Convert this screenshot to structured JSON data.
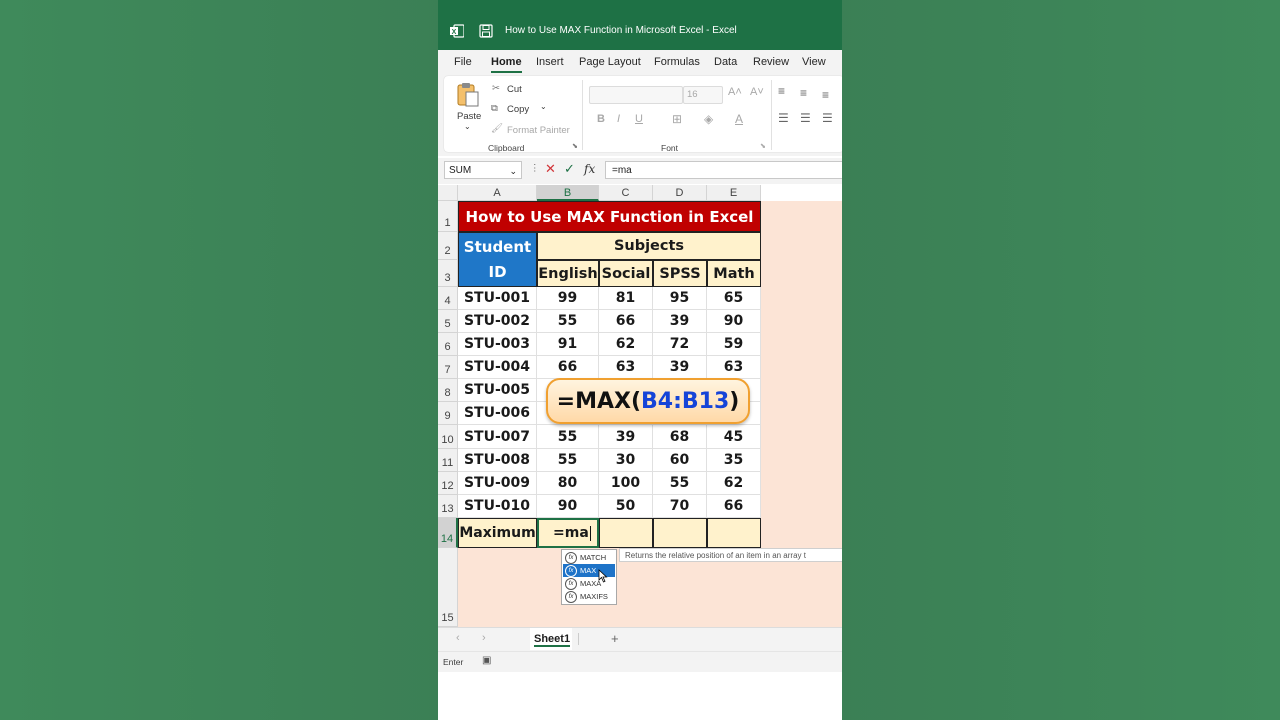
{
  "window": {
    "title": "How to Use MAX Function in Microsoft Excel  -  Excel"
  },
  "tabs": [
    "File",
    "Home",
    "Insert",
    "Page Layout",
    "Formulas",
    "Data",
    "Review",
    "View"
  ],
  "active_tab": "Home",
  "ribbon": {
    "paste": "Paste",
    "cut": "Cut",
    "copy": "Copy",
    "format_painter": "Format Painter",
    "clipboard_group": "Clipboard",
    "font_size": "16",
    "font_group": "Font",
    "bold": "B",
    "italic": "I",
    "underline": "U"
  },
  "formula_bar": {
    "name_box": "SUM",
    "fx": "fx",
    "content": "=ma"
  },
  "columns": [
    "A",
    "B",
    "C",
    "D",
    "E"
  ],
  "rows": [
    "1",
    "2",
    "3",
    "4",
    "5",
    "6",
    "7",
    "8",
    "9",
    "10",
    "11",
    "12",
    "13",
    "14",
    "15"
  ],
  "table": {
    "title": "How to Use MAX Function in Excel",
    "student_id_header": "Student ID",
    "subjects_header": "Subjects",
    "subject_names": [
      "English",
      "Social",
      "SPSS",
      "Math"
    ],
    "students": [
      {
        "id": "STU-001",
        "scores": [
          "99",
          "81",
          "95",
          "65"
        ]
      },
      {
        "id": "STU-002",
        "scores": [
          "55",
          "66",
          "39",
          "90"
        ]
      },
      {
        "id": "STU-003",
        "scores": [
          "91",
          "62",
          "72",
          "59"
        ]
      },
      {
        "id": "STU-004",
        "scores": [
          "66",
          "63",
          "39",
          "63"
        ]
      },
      {
        "id": "STU-005",
        "scores": [
          "",
          "",
          "",
          ""
        ]
      },
      {
        "id": "STU-006",
        "scores": [
          "",
          "",
          "",
          ""
        ]
      },
      {
        "id": "STU-007",
        "scores": [
          "55",
          "39",
          "68",
          "45"
        ]
      },
      {
        "id": "STU-008",
        "scores": [
          "55",
          "30",
          "60",
          "35"
        ]
      },
      {
        "id": "STU-009",
        "scores": [
          "80",
          "100",
          "55",
          "62"
        ]
      },
      {
        "id": "STU-010",
        "scores": [
          "90",
          "50",
          "70",
          "66"
        ]
      }
    ],
    "maximum_label": "Maximum",
    "editing_value": "=ma"
  },
  "autocomplete": {
    "items": [
      "MATCH",
      "MAX",
      "MAXA",
      "MAXIFS"
    ],
    "selected": "MAX",
    "tooltip": "Returns the relative position of an item in an array t"
  },
  "overlay": {
    "prefix": "=MAX(",
    "range": "B4:B13",
    "suffix": ")"
  },
  "sheet_tabs": {
    "active": "Sheet1"
  },
  "status": {
    "mode": "Enter"
  },
  "colors": {
    "excel_green": "#1e7145",
    "title_red": "#c00000",
    "id_blue": "#1f77c8",
    "header_yellow": "#fff2cc",
    "pink_bg": "#fce4d6"
  }
}
